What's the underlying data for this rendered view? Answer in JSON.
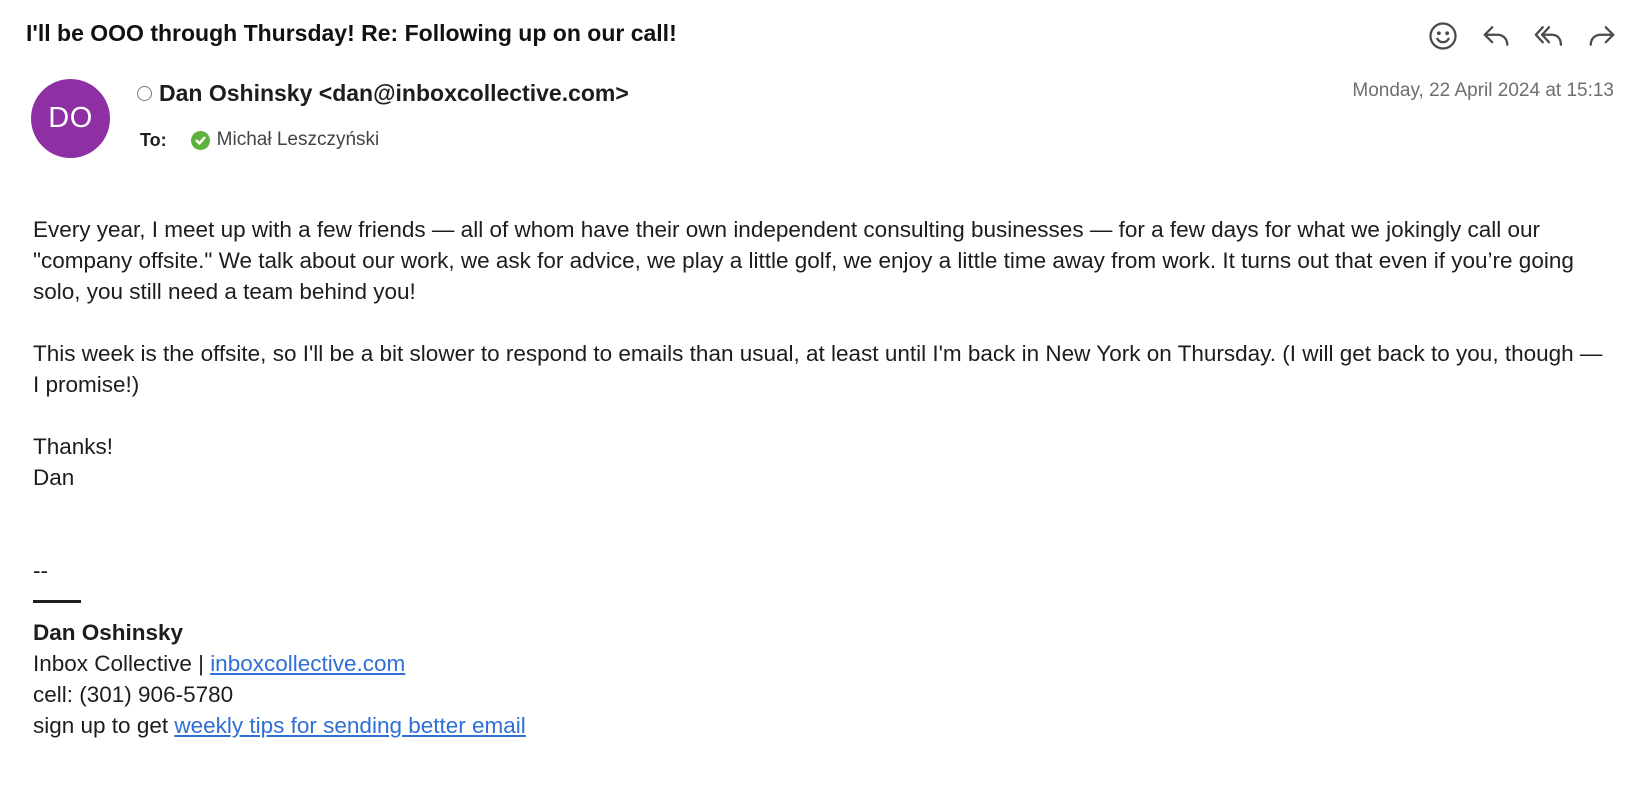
{
  "email": {
    "subject": "I'll be OOO through Thursday! Re: Following up on our call!",
    "avatar_initials": "DO",
    "avatar_color": "#8e2fa3",
    "sender": "Dan Oshinsky <dan@inboxcollective.com>",
    "date": "Monday, 22 April 2024 at 15:13",
    "to_label": "To:",
    "recipient": "Michał Leszczyński",
    "recipient_status_color": "#5cb23d"
  },
  "actions": [
    {
      "name": "emoji-reaction-icon"
    },
    {
      "name": "reply-icon"
    },
    {
      "name": "reply-all-icon"
    },
    {
      "name": "forward-icon"
    }
  ],
  "body": {
    "paragraph1": "Every year, I meet up with a few friends — all of whom have their own independent consulting businesses — for a few days for what we jokingly call our \"company offsite.\" We talk about our work, we ask for advice, we play a little golf, we enjoy a little time away from work. It turns out that even if you’re going solo, you still need a team behind you!",
    "paragraph2": "This week is the offsite, so I'll be a bit slower to respond to emails than usual, at least until I'm back in New York on Thursday. (I will get back to you, though — I promise!)",
    "closing": "Thanks!",
    "signoff": "Dan",
    "sig_separator": "--"
  },
  "signature": {
    "name": "Dan Oshinsky",
    "company_prefix": "Inbox Collective | ",
    "company_link": "inboxcollective.com",
    "cell": "cell: (301) 906-5780",
    "signup_prefix": "sign up to get ",
    "signup_link": "weekly tips for sending better email",
    "link_color": "#2f6fd6"
  }
}
